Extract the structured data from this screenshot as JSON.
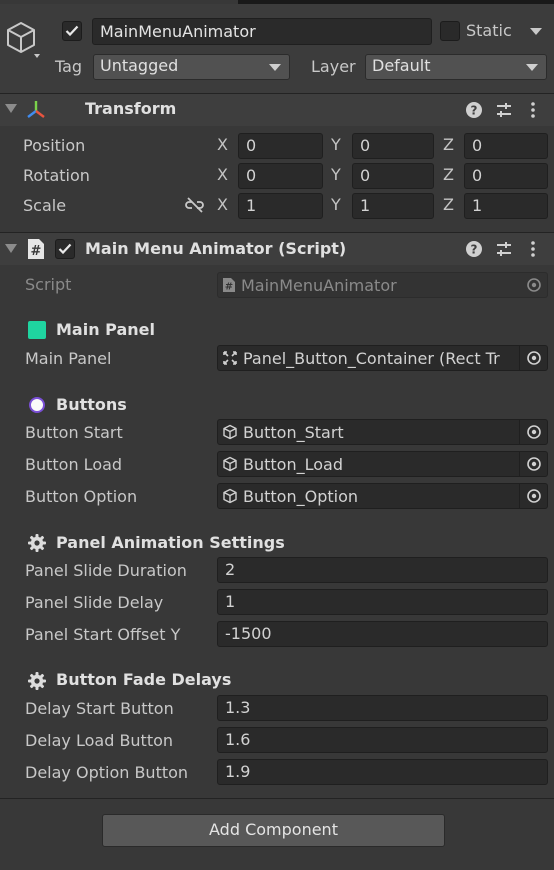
{
  "object": {
    "name": "MainMenuAnimator",
    "static_label": "Static",
    "tag_label": "Tag",
    "tag_value": "Untagged",
    "layer_label": "Layer",
    "layer_value": "Default"
  },
  "transform": {
    "title": "Transform",
    "rows": [
      {
        "label": "Position",
        "x": "0",
        "y": "0",
        "z": "0"
      },
      {
        "label": "Rotation",
        "x": "0",
        "y": "0",
        "z": "0"
      },
      {
        "label": "Scale",
        "x": "1",
        "y": "1",
        "z": "1"
      }
    ],
    "axis_x": "X",
    "axis_y": "Y",
    "axis_z": "Z"
  },
  "script_component": {
    "title": "Main Menu Animator (Script)",
    "script_label": "Script",
    "script_value": "MainMenuAnimator",
    "sections": {
      "main_panel": {
        "header": "Main Panel",
        "field_label": "Main Panel",
        "field_value": "Panel_Button_Container (Rect Tr"
      },
      "buttons": {
        "header": "Buttons",
        "fields": [
          {
            "label": "Button Start",
            "value": "Button_Start"
          },
          {
            "label": "Button Load",
            "value": "Button_Load"
          },
          {
            "label": "Button Option",
            "value": "Button_Option"
          }
        ]
      },
      "panel_animation": {
        "header": "Panel Animation Settings",
        "fields": [
          {
            "label": "Panel Slide Duration",
            "value": "2"
          },
          {
            "label": "Panel Slide Delay",
            "value": "1"
          },
          {
            "label": "Panel Start Offset Y",
            "value": "-1500"
          }
        ]
      },
      "button_fade": {
        "header": "Button Fade Delays",
        "fields": [
          {
            "label": "Delay Start Button",
            "value": "1.3"
          },
          {
            "label": "Delay Load Button",
            "value": "1.6"
          },
          {
            "label": "Delay Option Button",
            "value": "1.9"
          }
        ]
      }
    }
  },
  "add_component_label": "Add Component",
  "colors": {
    "main_panel_swatch": "#1fd4a0",
    "accent_check": "#e8e8e8"
  },
  "icons": {
    "gameobject": "cube-icon",
    "transform": "transform-axes-icon",
    "script": "script-hash-icon",
    "help": "help-icon",
    "presets": "presets-sliders-icon",
    "menu": "kebab-menu-icon",
    "link": "unlinked-scale-icon",
    "settings": "gear-icon",
    "object_picker": "object-picker-icon"
  }
}
